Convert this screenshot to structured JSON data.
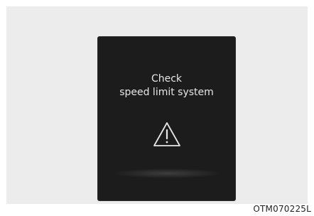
{
  "screen": {
    "message_line1": "Check",
    "message_line2": "speed limit system",
    "icon": "warning-triangle-icon"
  },
  "figure_code": "OTM070225L",
  "colors": {
    "frame_background": "#ececec",
    "display_background": "#1c1c1c",
    "text": "#e6e6e6"
  }
}
